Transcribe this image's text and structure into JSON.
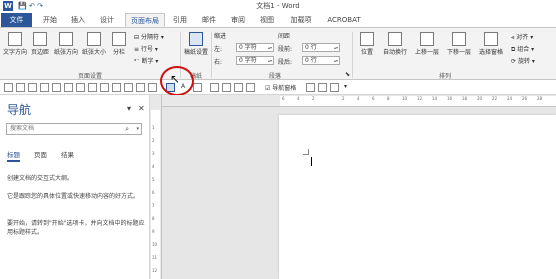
{
  "window": {
    "title": "文档1 - Word",
    "app_icon_label": "W",
    "qat_items": [
      "💾",
      "↶",
      "↷"
    ]
  },
  "tabs": {
    "file": "文件",
    "items": [
      "开始",
      "插入",
      "设计",
      "页面布局",
      "引用",
      "邮件",
      "审阅",
      "视图",
      "加载项",
      "ACROBAT"
    ],
    "active": "页面布局"
  },
  "ribbon": {
    "page_setup": {
      "text_direction": "文字方向",
      "margins": "页边距",
      "orientation": "纸张方向",
      "size": "纸张大小",
      "columns": "分栏",
      "breaks": "分隔符",
      "line_numbers": "行号",
      "hyphenation": "断字",
      "label": "页面设置"
    },
    "manuscript": {
      "button": "稿纸设置",
      "label": "稿纸"
    },
    "paragraph": {
      "indent_label": "缩进",
      "spacing_label": "间距",
      "left_label": "左:",
      "right_label": "右:",
      "before_label": "段前:",
      "after_label": "段后:",
      "left_value": "0 字符",
      "right_value": "0 字符",
      "before_value": "0 行",
      "after_value": "0 行",
      "label": "段落"
    },
    "arrange": {
      "position": "位置",
      "wrap_text": "自动换行",
      "bring_forward": "上移一层",
      "send_backward": "下移一层",
      "selection_pane": "选择窗格",
      "align": "对齐",
      "group": "组合",
      "rotate": "旋转",
      "label": "排列"
    }
  },
  "quickbar": {
    "a_label": "A",
    "nav_pane_checkbox_label": "导航窗格",
    "nav_pane_checked": true
  },
  "nav_pane": {
    "title": "导航",
    "search_placeholder": "搜索文档",
    "tabs": [
      "标题",
      "页面",
      "结果"
    ],
    "active_tab": "标题",
    "help_paragraphs": [
      "创建文档的交互式大纲。",
      "它是跟踪您的具体位置或快速移动内容的好方式。",
      "要开始，请转到\"开始\"选项卡，并向文档中的标题应用标题样式。"
    ]
  },
  "rulers": {
    "h_ticks": [
      "6",
      "4",
      "2",
      "",
      "2",
      "4",
      "6",
      "8",
      "10",
      "12",
      "14",
      "16",
      "18",
      "20",
      "22",
      "24",
      "26",
      "28"
    ],
    "v_ticks": [
      "1",
      "2",
      "3",
      "4",
      "5",
      "6",
      "7",
      "8",
      "9",
      "10",
      "11",
      "12"
    ]
  },
  "colors": {
    "accent": "#2b579a",
    "highlight_circle": "#d01010"
  }
}
